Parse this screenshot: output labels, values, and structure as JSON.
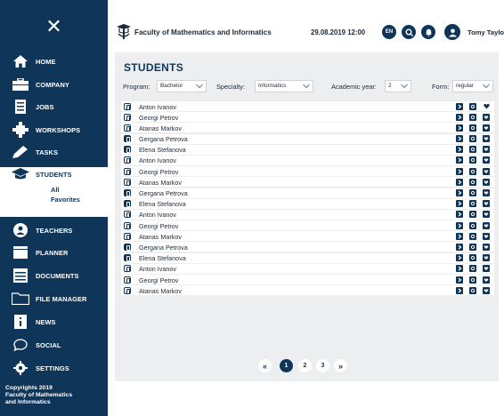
{
  "sidebar": {
    "close_icon": "close-icon",
    "items": [
      {
        "label": "HOME",
        "icon": "home-icon"
      },
      {
        "label": "COMPANY",
        "icon": "briefcase-icon"
      },
      {
        "label": "JOBS",
        "icon": "document-list-icon"
      },
      {
        "label": "WORKSHOPS",
        "icon": "puzzle-icon"
      },
      {
        "label": "TASKS",
        "icon": "pencil-icon"
      },
      {
        "label": "STUDENTS",
        "icon": "graduation-cap-icon"
      },
      {
        "label": "TEACHERS",
        "icon": "teacher-icon"
      },
      {
        "label": "PLANNER",
        "icon": "calendar-icon"
      },
      {
        "label": "DOCUMENTS",
        "icon": "stack-icon"
      },
      {
        "label": "FILE MANAGER",
        "icon": "folder-icon"
      },
      {
        "label": "NEWS",
        "icon": "info-icon"
      },
      {
        "label": "SOCIAL",
        "icon": "chat-bubble-icon"
      },
      {
        "label": "SETTINGS",
        "icon": "gear-icon"
      }
    ],
    "students_sub": [
      "All",
      "Favorites"
    ],
    "footer": [
      "Copyrights 2019",
      "Faculty of Mathematics",
      "and Informatics"
    ]
  },
  "header": {
    "faculty": "Faculty of Mathematics and Informatics",
    "datetime": "29.08.2019  12:00",
    "lang": "EN",
    "username": "Tomy Taylor"
  },
  "main": {
    "title": "STUDENTS",
    "filters": [
      {
        "label": "Program:",
        "value": "Bachelor"
      },
      {
        "label": "Specialty:",
        "value": "Informatics"
      },
      {
        "label": "Academic year:",
        "value": "2"
      },
      {
        "label": "Form:",
        "value": "regular"
      }
    ],
    "students": [
      {
        "name": "Anton Ivanov",
        "icon": "student-icon",
        "filled": false,
        "favorite": true
      },
      {
        "name": "Georgi Petrov",
        "icon": "student-icon",
        "filled": false,
        "favorite": false
      },
      {
        "name": "Atanas Markov",
        "icon": "student-icon",
        "filled": false,
        "favorite": false
      },
      {
        "name": "Gergana Petrova",
        "icon": "student-icon",
        "filled": true,
        "favorite": false
      },
      {
        "name": "Elena Stefanova",
        "icon": "student-icon",
        "filled": true,
        "favorite": false
      },
      {
        "name": "Anton Ivanov",
        "icon": "student-icon",
        "filled": false,
        "favorite": false
      },
      {
        "name": "Georgi Petrov",
        "icon": "student-icon",
        "filled": false,
        "favorite": false
      },
      {
        "name": "Atanas Markov",
        "icon": "student-icon",
        "filled": false,
        "favorite": false
      },
      {
        "name": "Gergana Petrova",
        "icon": "student-icon",
        "filled": true,
        "favorite": false
      },
      {
        "name": "Elena Stefanova",
        "icon": "student-icon",
        "filled": true,
        "favorite": false
      },
      {
        "name": "Anton Ivanov",
        "icon": "student-icon",
        "filled": false,
        "favorite": false
      },
      {
        "name": "Georgi Petrov",
        "icon": "student-icon",
        "filled": false,
        "favorite": false
      },
      {
        "name": "Atanas Markov",
        "icon": "student-icon",
        "filled": false,
        "favorite": false
      },
      {
        "name": "Gergana Petrova",
        "icon": "student-icon",
        "filled": true,
        "favorite": false
      },
      {
        "name": "Elena Stefanova",
        "icon": "student-icon",
        "filled": true,
        "favorite": false
      },
      {
        "name": "Anton Ivanov",
        "icon": "student-icon",
        "filled": false,
        "favorite": false
      },
      {
        "name": "Georgi Petrov",
        "icon": "student-icon",
        "filled": false,
        "favorite": false
      },
      {
        "name": "Atanas Markov",
        "icon": "student-icon",
        "filled": false,
        "favorite": false
      }
    ],
    "pagination": {
      "prev": "«",
      "pages": [
        "1",
        "2",
        "3"
      ],
      "current": "1",
      "next": "»"
    }
  },
  "colors": {
    "primary": "#0f3659",
    "panel_bg": "#eceef0"
  }
}
